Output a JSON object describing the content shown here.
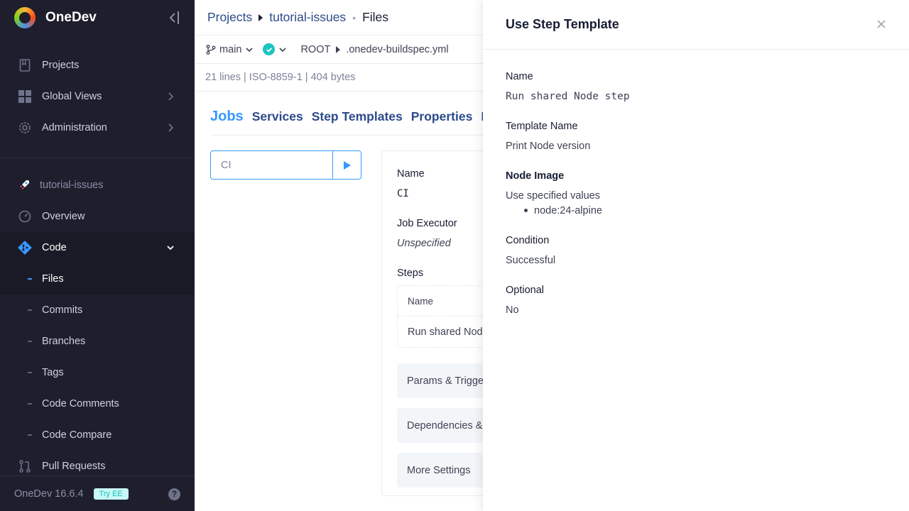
{
  "app": {
    "name": "OneDev",
    "version": "OneDev 16.6.4",
    "try_ee": "Try EE"
  },
  "sidebar": {
    "top_items": [
      {
        "label": "Projects",
        "icon": "bookmark-icon"
      },
      {
        "label": "Global Views",
        "icon": "grid-icon"
      },
      {
        "label": "Administration",
        "icon": "gear-icon"
      }
    ],
    "project": "tutorial-issues",
    "project_items": [
      {
        "label": "Overview",
        "icon": "gauge-icon"
      },
      {
        "label": "Code",
        "icon": "git-icon"
      }
    ],
    "code_sub_items": [
      "Files",
      "Commits",
      "Branches",
      "Tags",
      "Code Comments",
      "Code Compare"
    ],
    "pull_requests": "Pull Requests"
  },
  "breadcrumb": {
    "projects": "Projects",
    "project": "tutorial-issues",
    "page": "Files"
  },
  "filebar": {
    "branch": "main",
    "root": "ROOT",
    "file": ".onedev-buildspec.yml"
  },
  "fileinfo": "21 lines | ISO-8859-1 | 404 bytes",
  "tabs": [
    "Jobs",
    "Services",
    "Step Templates",
    "Properties",
    "In"
  ],
  "job": {
    "name_value": "CI",
    "name_label": "Name",
    "executor_label": "Job Executor",
    "executor_value": "Unspecified",
    "steps_label": "Steps",
    "steps_header": "Name",
    "step_row": "Run shared Node step",
    "sections": [
      "Params & Triggers",
      "Dependencies & Jobs",
      "More Settings"
    ]
  },
  "panel": {
    "title": "Use Step Template",
    "fields": {
      "name_label": "Name",
      "name_value": "Run shared Node step",
      "template_label": "Template Name",
      "template_value": "Print Node version",
      "image_label": "Node Image",
      "image_mode": "Use specified values",
      "image_value": "node:24-alpine",
      "condition_label": "Condition",
      "condition_value": "Successful",
      "optional_label": "Optional",
      "optional_value": "No"
    }
  },
  "colors": {
    "sidebar_bg": "#1e1e2d",
    "accent": "#3699ff",
    "success": "#1bc5bd"
  }
}
